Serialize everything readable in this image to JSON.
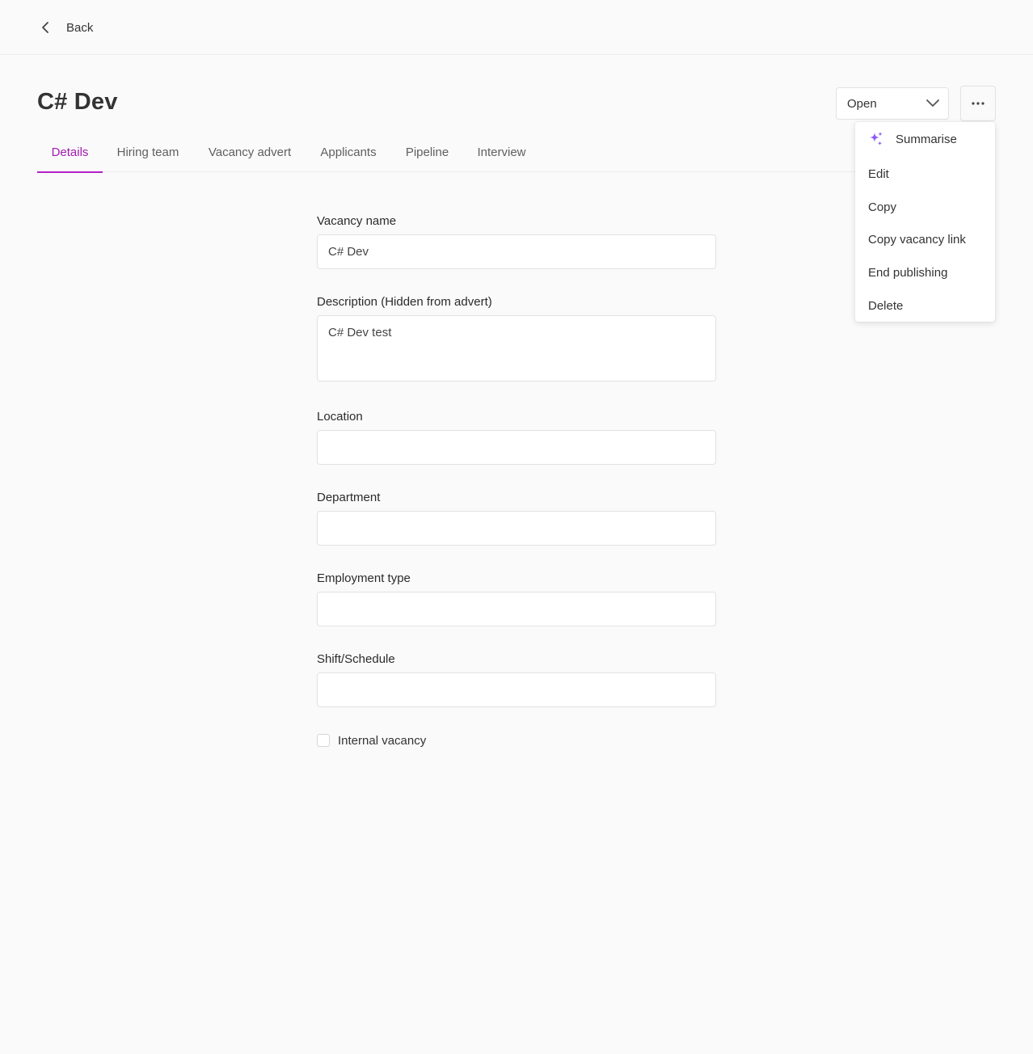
{
  "nav": {
    "back_label": "Back"
  },
  "header": {
    "title": "C# Dev"
  },
  "status": {
    "value": "Open"
  },
  "tabs": [
    {
      "label": "Details",
      "active": true
    },
    {
      "label": "Hiring team",
      "active": false
    },
    {
      "label": "Vacancy advert",
      "active": false
    },
    {
      "label": "Applicants",
      "active": false
    },
    {
      "label": "Pipeline",
      "active": false
    },
    {
      "label": "Interview",
      "active": false
    }
  ],
  "form": {
    "vacancy_name": {
      "label": "Vacancy name",
      "value": "C# Dev"
    },
    "description": {
      "label": "Description (Hidden from advert)",
      "value": "C# Dev test"
    },
    "location": {
      "label": "Location",
      "value": ""
    },
    "department": {
      "label": "Department",
      "value": ""
    },
    "employment_type": {
      "label": "Employment type",
      "value": ""
    },
    "shift_schedule": {
      "label": "Shift/Schedule",
      "value": ""
    },
    "internal_vacancy": {
      "label": "Internal vacancy",
      "checked": false
    }
  },
  "more_menu": {
    "items": [
      {
        "label": "Summarise",
        "icon": "sparkle-icon"
      },
      {
        "label": "Edit"
      },
      {
        "label": "Copy"
      },
      {
        "label": "Copy vacancy link"
      },
      {
        "label": "End publishing"
      },
      {
        "label": "Delete"
      }
    ]
  },
  "colors": {
    "accent": "#a21caf",
    "sparkle": "#8b5cf6",
    "background": "#fafafa"
  }
}
